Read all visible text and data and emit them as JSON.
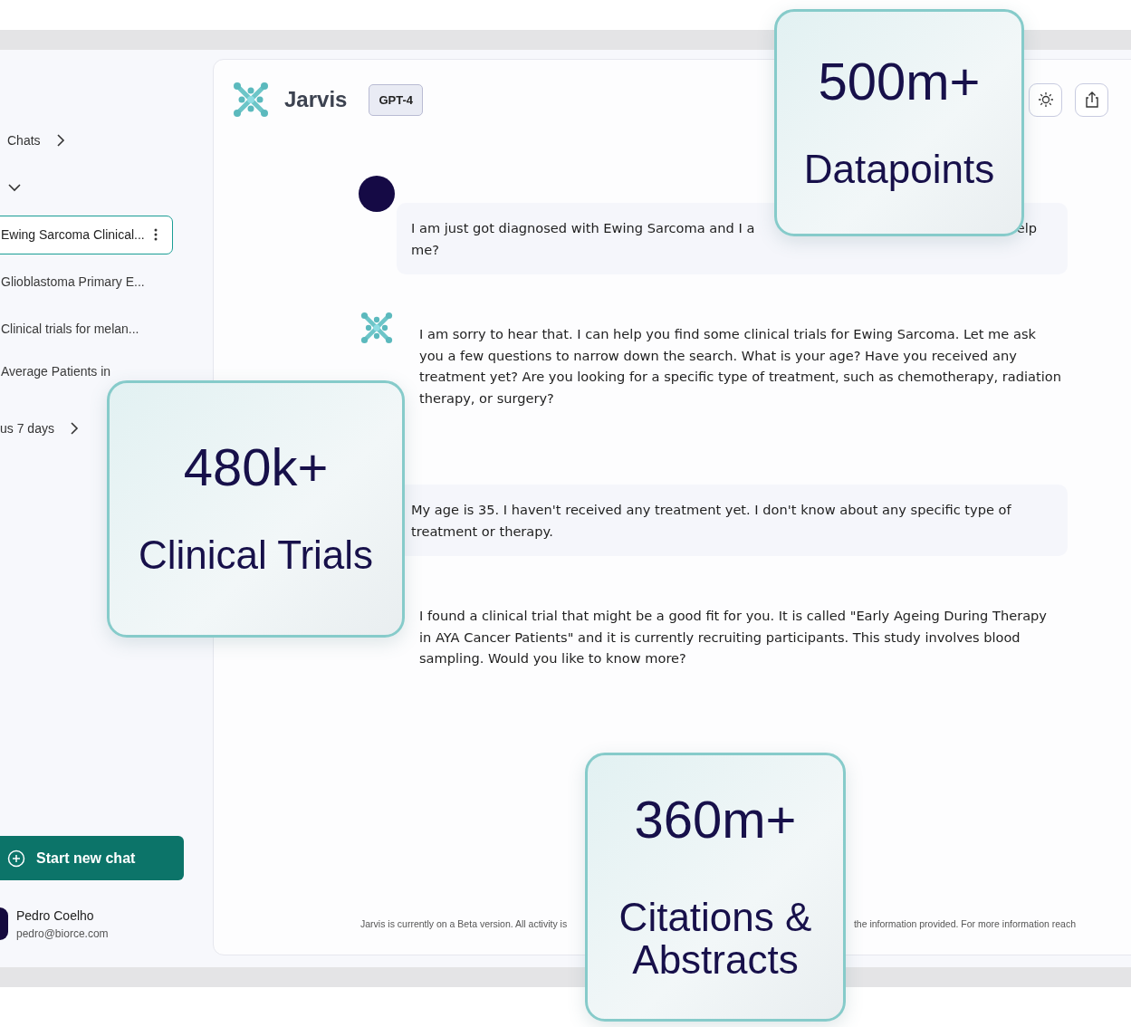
{
  "sidebar": {
    "sections": [
      {
        "label": "Chats",
        "expanded": false
      },
      {
        "expanded": true
      }
    ],
    "items": [
      {
        "label": "Ewing Sarcoma Clinical...",
        "selected": true
      },
      {
        "label": "Glioblastoma Primary E...",
        "selected": false
      },
      {
        "label": "Clinical trials for melan...",
        "selected": false
      },
      {
        "label": "Average Patients in",
        "selected": false
      }
    ],
    "footer_section": {
      "label": "us 7 days",
      "expanded": false
    },
    "new_chat_button": "Start new chat",
    "user": {
      "name": "Pedro Coelho",
      "email": "pedro@biorce.com"
    }
  },
  "header": {
    "title": "Jarvis",
    "model_badge": "GPT-4"
  },
  "messages": [
    {
      "kind": "user",
      "avatar": true,
      "first_line_start": "I am just got diagnosed with Ewing Sarcoma and I a",
      "first_line_end": "elp",
      "rest": "me?"
    },
    {
      "kind": "assistant",
      "avatar": true,
      "text": "I am sorry to hear that. I can help you find some clinical trials for Ewing Sarcoma. Let me ask you a few questions to narrow down the search. What is your age? Have you received any treatment yet? Are you looking for a specific type of treatment, such as chemotherapy, radiation therapy, or surgery?"
    },
    {
      "kind": "user",
      "avatar": false,
      "text": "My age is 35. I haven't received any treatment yet. I don't know about any specific type of treatment or therapy."
    },
    {
      "kind": "assistant",
      "avatar": false,
      "text": "I found a clinical trial that might be a good fit for you. It is called \"Early Ageing During Therapy in AYA Cancer Patients\" and it is currently recruiting participants. This study involves blood sampling. Would you like to know more?"
    }
  ],
  "disclaimer": {
    "start": "Jarvis is currently on a Beta version. All activity is",
    "end": "the information provided. For more information reach"
  },
  "stats": [
    {
      "value": "500m+",
      "label": "Datapoints"
    },
    {
      "value": "480k+",
      "label": "Clinical Trials"
    },
    {
      "value": "360m+",
      "label": "Citations & Abstracts"
    }
  ]
}
